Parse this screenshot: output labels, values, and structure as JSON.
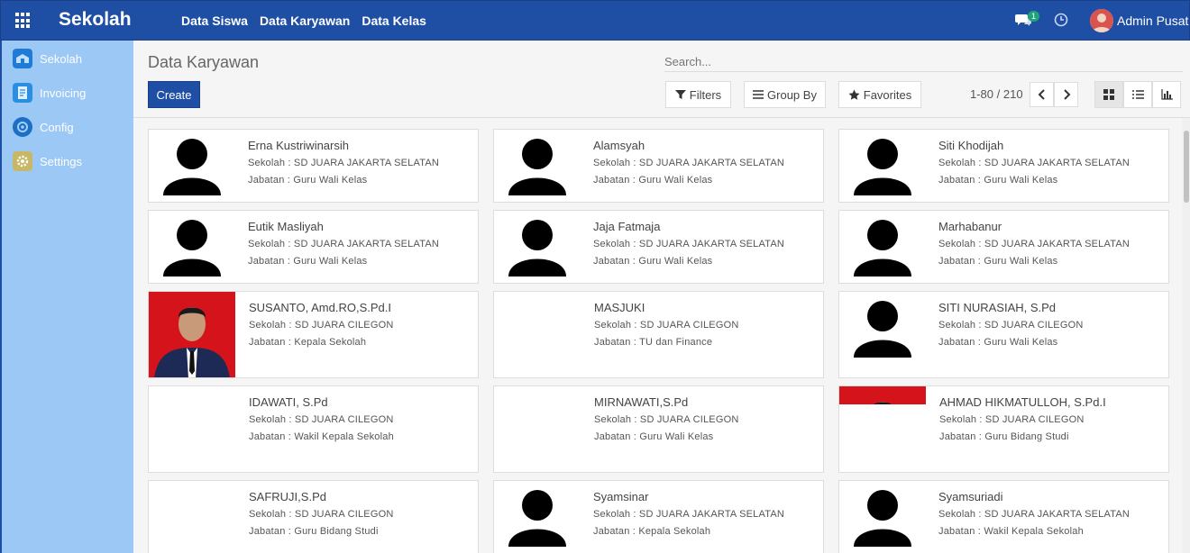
{
  "app": {
    "brand": "Sekolah"
  },
  "topmenu": [
    "Data Siswa",
    "Data Karyawan",
    "Data Kelas"
  ],
  "notifications": {
    "chat_count": "1"
  },
  "user": {
    "name": "Admin Pusat"
  },
  "sidebar": {
    "items": [
      {
        "label": "Sekolah",
        "icon": "school-icon",
        "color": "#1f7bd6"
      },
      {
        "label": "Invoicing",
        "icon": "invoice-icon",
        "color": "#2a8fe0"
      },
      {
        "label": "Config",
        "icon": "config-icon",
        "color": "#1c6fc2"
      },
      {
        "label": "Settings",
        "icon": "gear-icon",
        "color": "#c8b865"
      }
    ]
  },
  "control": {
    "title": "Data Karyawan",
    "search_placeholder": "Search...",
    "create_label": "Create",
    "filters_label": "Filters",
    "groupby_label": "Group By",
    "favorites_label": "Favorites",
    "pager": "1-80 / 210"
  },
  "cards": [
    {
      "name": "Erna Kustriwinarsih",
      "sekolah": "Sekolah : SD JUARA JAKARTA SELATAN",
      "jabatan": "Jabatan : Guru Wali Kelas",
      "image": "silhouette"
    },
    {
      "name": "Alamsyah",
      "sekolah": "Sekolah : SD JUARA JAKARTA SELATAN",
      "jabatan": "Jabatan : Guru Wali Kelas",
      "image": "silhouette"
    },
    {
      "name": "Siti Khodijah",
      "sekolah": "Sekolah : SD JUARA JAKARTA SELATAN",
      "jabatan": "Jabatan : Guru Wali Kelas",
      "image": "silhouette"
    },
    {
      "name": "Eutik Masliyah",
      "sekolah": "Sekolah : SD JUARA JAKARTA SELATAN",
      "jabatan": "Jabatan : Guru Wali Kelas",
      "image": "silhouette"
    },
    {
      "name": "Jaja Fatmaja",
      "sekolah": "Sekolah : SD JUARA JAKARTA SELATAN",
      "jabatan": "Jabatan : Guru Wali Kelas",
      "image": "silhouette"
    },
    {
      "name": "Marhabanur",
      "sekolah": "Sekolah : SD JUARA JAKARTA SELATAN",
      "jabatan": "Jabatan : Guru Wali Kelas",
      "image": "silhouette"
    },
    {
      "name": "SUSANTO, Amd.RO,S.Pd.I",
      "sekolah": "Sekolah : SD JUARA CILEGON",
      "jabatan": "Jabatan : Kepala Sekolah",
      "image": "photo"
    },
    {
      "name": "MASJUKI",
      "sekolah": "Sekolah : SD JUARA CILEGON",
      "jabatan": "Jabatan : TU dan Finance",
      "image": "none"
    },
    {
      "name": "SITI NURASIAH, S.Pd",
      "sekolah": "Sekolah : SD JUARA CILEGON",
      "jabatan": "Jabatan : Guru Wali Kelas",
      "image": "silhouette"
    },
    {
      "name": "IDAWATI, S.Pd",
      "sekolah": "Sekolah : SD JUARA CILEGON",
      "jabatan": "Jabatan : Wakil Kepala Sekolah",
      "image": "none"
    },
    {
      "name": "MIRNAWATI,S.Pd",
      "sekolah": "Sekolah : SD JUARA CILEGON",
      "jabatan": "Jabatan : Guru Wali Kelas",
      "image": "none"
    },
    {
      "name": "AHMAD HIKMATULLOH, S.Pd.I",
      "sekolah": "Sekolah : SD JUARA CILEGON",
      "jabatan": "Jabatan : Guru Bidang Studi",
      "image": "photo-small"
    },
    {
      "name": "SAFRUJI,S.Pd",
      "sekolah": "Sekolah : SD JUARA CILEGON",
      "jabatan": "Jabatan : Guru Bidang Studi",
      "image": "none"
    },
    {
      "name": "Syamsinar",
      "sekolah": "Sekolah : SD JUARA JAKARTA SELATAN",
      "jabatan": "Jabatan : Kepala Sekolah",
      "image": "silhouette"
    },
    {
      "name": "Syamsuriadi",
      "sekolah": "Sekolah : SD JUARA JAKARTA SELATAN",
      "jabatan": "Jabatan : Wakil Kepala Sekolah",
      "image": "silhouette"
    }
  ]
}
